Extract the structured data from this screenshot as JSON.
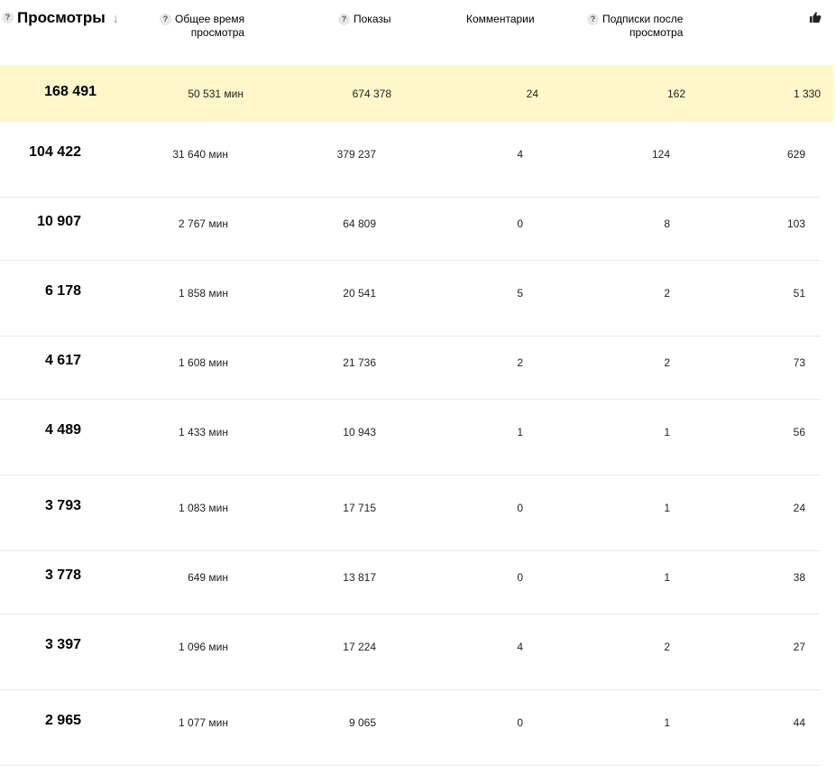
{
  "header": {
    "views_label": "Просмотры",
    "watch_time_label": "Общее время просмотра",
    "watch_time_line1": "Общее время",
    "watch_time_line2": "просмотра",
    "impressions_label": "Показы",
    "comments_label": "Комментарии",
    "subs_label": "Подписки после просмотра",
    "subs_line1": "Подписки после",
    "subs_line2": "просмотра",
    "help_mark": "?",
    "sort_icon": "arrow-down-icon",
    "likes_icon": "thumbs-up-icon"
  },
  "rows": [
    {
      "views": "168 491",
      "watch_time": "50 531 мин",
      "impressions": "674 378",
      "comments": "24",
      "subs": "162",
      "likes": "1 330",
      "highlighted": true
    },
    {
      "views": "104 422",
      "watch_time": "31 640 мин",
      "impressions": "379 237",
      "comments": "4",
      "subs": "124",
      "likes": "629"
    },
    {
      "views": "10 907",
      "watch_time": "2 767 мин",
      "impressions": "64 809",
      "comments": "0",
      "subs": "8",
      "likes": "103"
    },
    {
      "views": "6 178",
      "watch_time": "1 858 мин",
      "impressions": "20 541",
      "comments": "5",
      "subs": "2",
      "likes": "51"
    },
    {
      "views": "4 617",
      "watch_time": "1 608 мин",
      "impressions": "21 736",
      "comments": "2",
      "subs": "2",
      "likes": "73"
    },
    {
      "views": "4 489",
      "watch_time": "1 433 мин",
      "impressions": "10 943",
      "comments": "1",
      "subs": "1",
      "likes": "56"
    },
    {
      "views": "3 793",
      "watch_time": "1 083 мин",
      "impressions": "17 715",
      "comments": "0",
      "subs": "1",
      "likes": "24"
    },
    {
      "views": "3 778",
      "watch_time": "649 мин",
      "impressions": "13 817",
      "comments": "0",
      "subs": "1",
      "likes": "38"
    },
    {
      "views": "3 397",
      "watch_time": "1 096 мин",
      "impressions": "17 224",
      "comments": "4",
      "subs": "2",
      "likes": "27"
    },
    {
      "views": "2 965",
      "watch_time": "1 077 мин",
      "impressions": "9 065",
      "comments": "0",
      "subs": "1",
      "likes": "44"
    }
  ],
  "colors": {
    "highlight_row": "#fff7c9",
    "divider": "#e9e9e9",
    "help_bg": "#e8e8e8"
  }
}
